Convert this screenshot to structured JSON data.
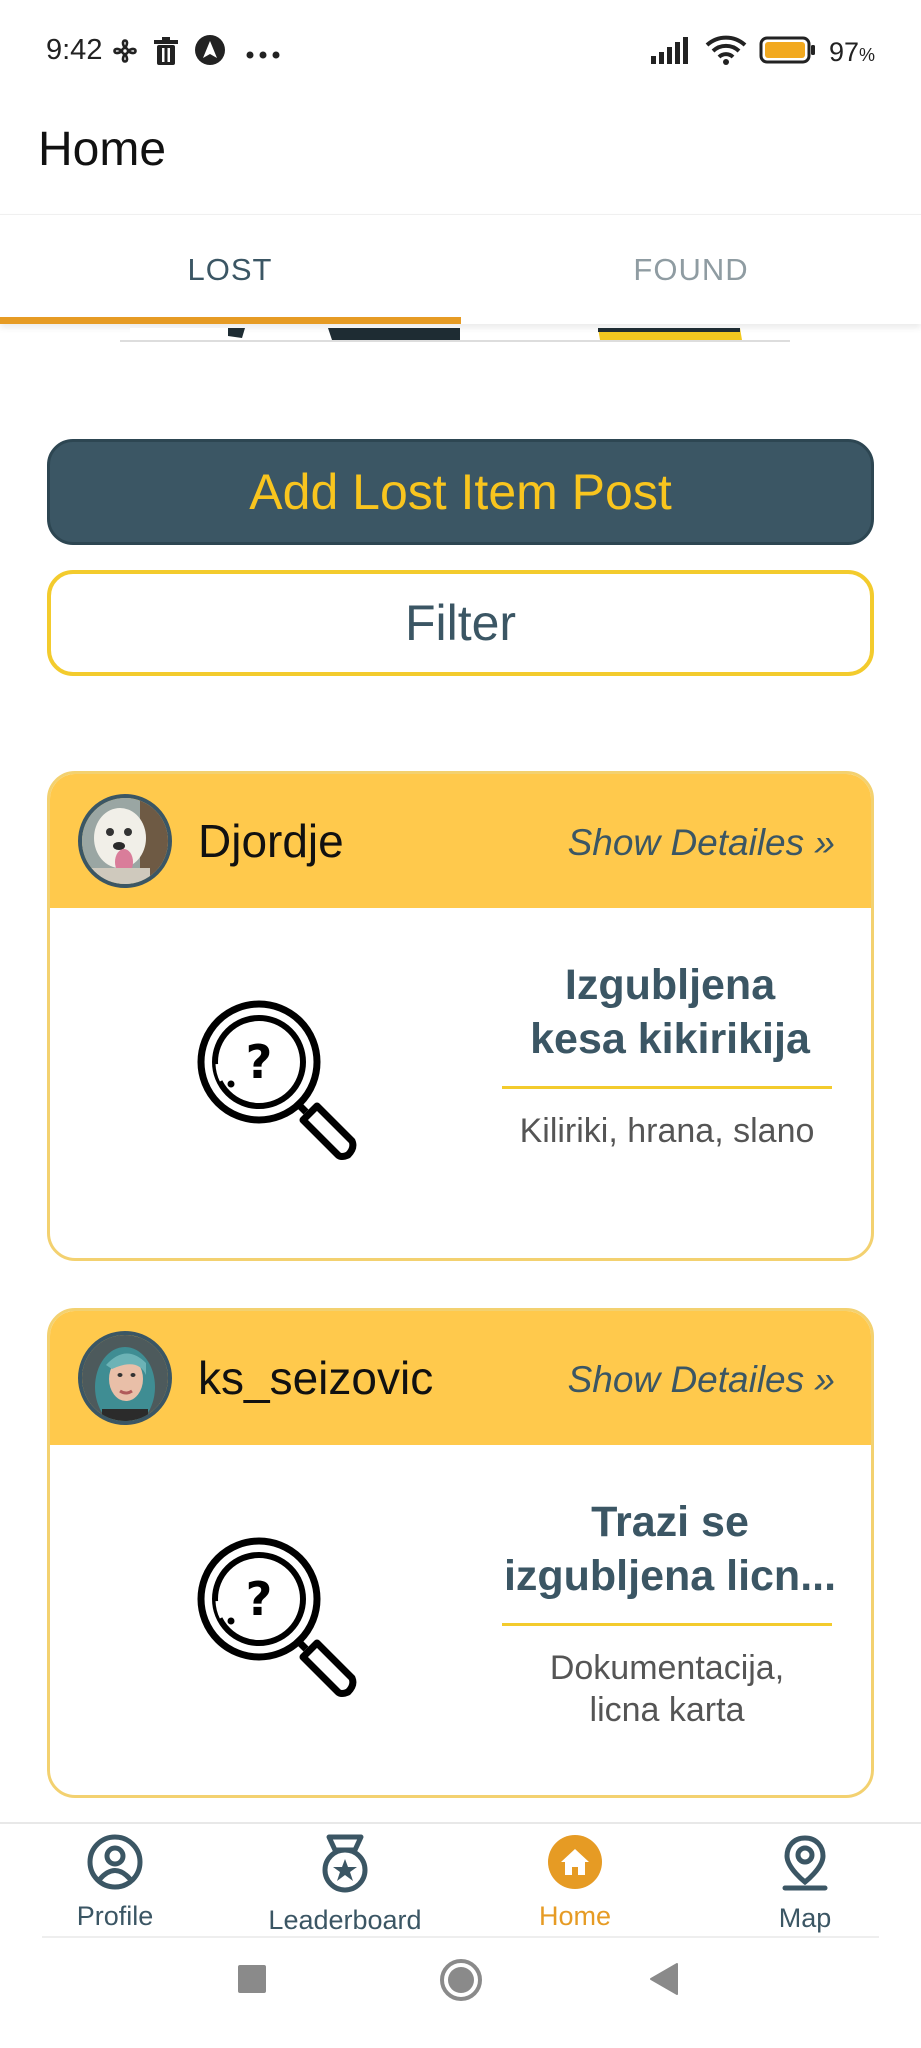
{
  "status_bar": {
    "time": "9:42",
    "battery_percent": "97",
    "battery_unit": "%",
    "icons": [
      "fan-icon",
      "trash-icon",
      "navigation-icon",
      "more-icon",
      "signal-icon",
      "wifi-icon",
      "battery-icon"
    ]
  },
  "app_bar": {
    "title": "Home"
  },
  "tabs": [
    {
      "label": "LOST",
      "active": true
    },
    {
      "label": "FOUND",
      "active": false
    }
  ],
  "actions": {
    "add_label": "Add Lost Item Post",
    "filter_label": "Filter"
  },
  "posts": [
    {
      "username": "Djordje",
      "details_label": "Show Detailes »",
      "title_line1": "Izgubljena",
      "title_line2": "kesa kikirikija",
      "tags_line1": "Kiliriki, hrana, slano",
      "tags_line2": ""
    },
    {
      "username": "ks_seizovic",
      "details_label": "Show Detailes »",
      "title_line1": "Trazi se",
      "title_line2": "izgubljena licn...",
      "tags_line1": "Dokumentacija,",
      "tags_line2": "licna karta"
    }
  ],
  "bottom_nav": [
    {
      "label": "Profile",
      "icon": "profile-icon",
      "active": false
    },
    {
      "label": "Leaderboard",
      "icon": "medal-icon",
      "active": false
    },
    {
      "label": "Home",
      "icon": "home-icon",
      "active": true
    },
    {
      "label": "Map",
      "icon": "map-pin-icon",
      "active": false
    }
  ],
  "colors": {
    "primary": "#3b5664",
    "accent": "#f9c51e",
    "card_header": "#ffc94c",
    "active_nav": "#e69b24"
  }
}
